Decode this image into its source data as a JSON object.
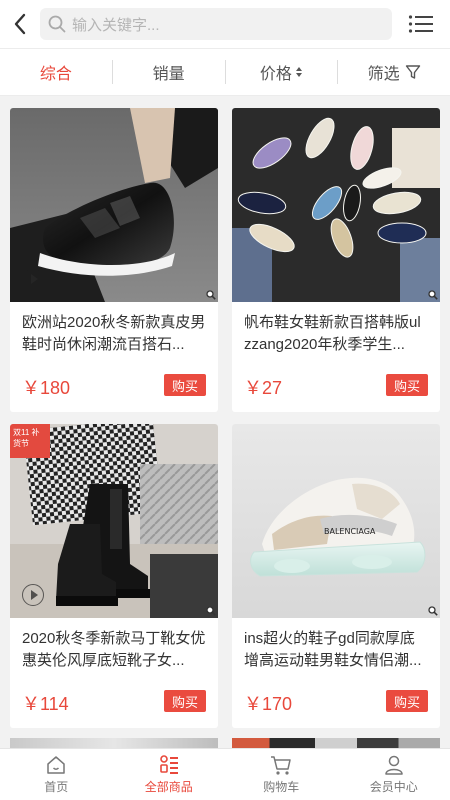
{
  "header": {
    "search_placeholder": "输入关键字..."
  },
  "sortbar": {
    "items": [
      "综合",
      "销量",
      "价格",
      "筛选"
    ],
    "active": "综合"
  },
  "products": [
    {
      "title": "欧洲站2020秋冬新款真皮男鞋时尚休闲潮流百搭石...",
      "price": "￥180",
      "buy": "购买"
    },
    {
      "title": "帆布鞋女鞋新款百搭韩版ulzzang2020年秋季学生...",
      "price": "￥27",
      "buy": "购买"
    },
    {
      "title": "2020秋冬季新款马丁靴女优惠英伦风厚底短靴子女...",
      "price": "￥114",
      "buy": "购买"
    },
    {
      "title": "ins超火的鞋子gd同款厚底增高运动鞋男鞋女情侣潮...",
      "price": "￥170",
      "buy": "购买"
    }
  ],
  "badge_text": "双11 补货节",
  "tabbar": {
    "items": [
      "首页",
      "全部商品",
      "购物车",
      "会员中心"
    ],
    "active": "全部商品"
  },
  "colors": {
    "accent": "#e8483b",
    "buy_button": "#ea4b3f"
  }
}
